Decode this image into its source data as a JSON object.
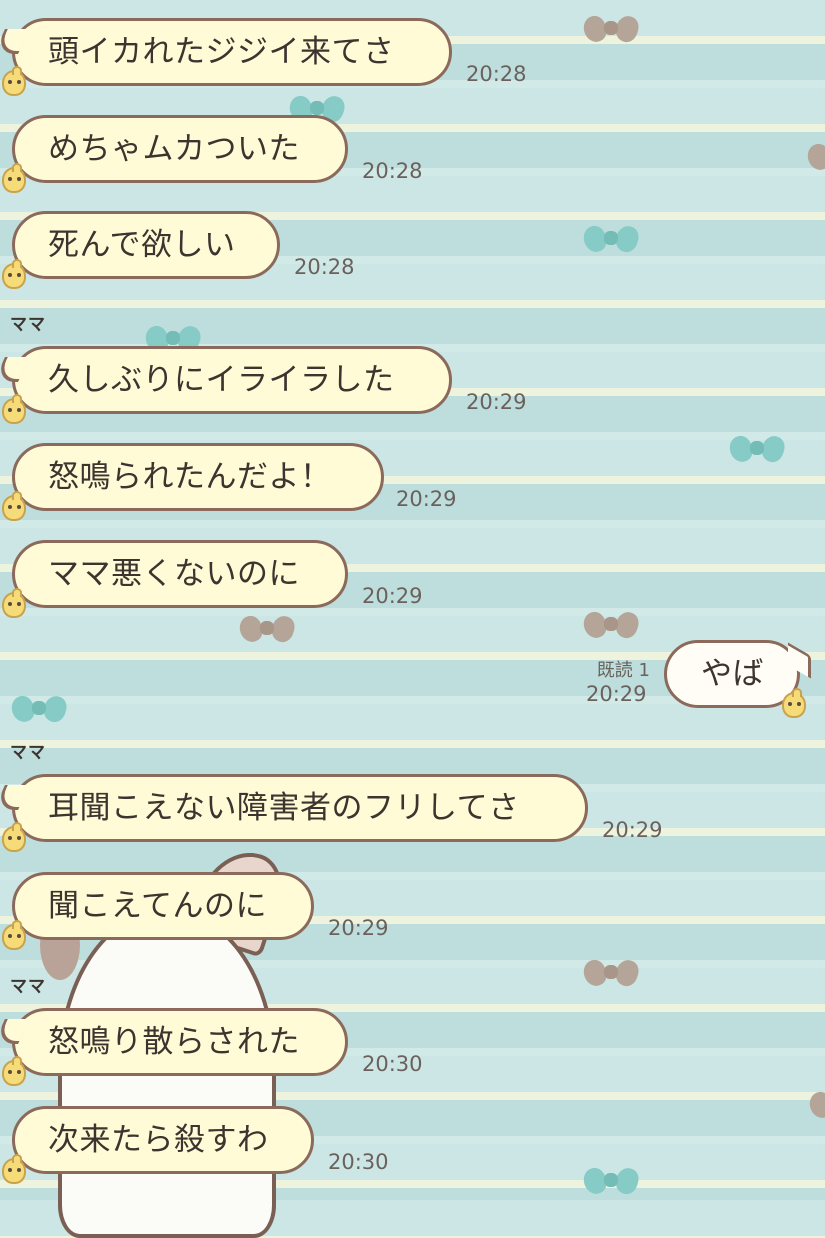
{
  "chat": {
    "messages": [
      {
        "sender": "",
        "text": "頭イカれたジジイ来てさ",
        "time": "20:28",
        "mine": false
      },
      {
        "sender": "",
        "text": "めちゃムカついた",
        "time": "20:28",
        "mine": false
      },
      {
        "sender": "",
        "text": "死んで欲しい",
        "time": "20:28",
        "mine": false
      },
      {
        "sender": "ママ",
        "text": "久しぶりにイライラした",
        "time": "20:29",
        "mine": false
      },
      {
        "sender": "",
        "text": "怒鳴られたんだよ！",
        "time": "20:29",
        "mine": false
      },
      {
        "sender": "",
        "text": "ママ悪くないのに",
        "time": "20:29",
        "mine": false
      },
      {
        "sender": "",
        "text": "やば",
        "time": "20:29",
        "mine": true,
        "read_status": "既読 1"
      },
      {
        "sender": "ママ",
        "text": "耳聞こえない障害者のフリしてさ",
        "time": "20:29",
        "mine": false
      },
      {
        "sender": "",
        "text": "聞こえてんのに",
        "time": "20:29",
        "mine": false
      },
      {
        "sender": "ママ",
        "text": "怒鳴り散らされた",
        "time": "20:30",
        "mine": false
      },
      {
        "sender": "",
        "text": "次来たら殺すわ",
        "time": "20:30",
        "mine": false
      }
    ]
  },
  "theme": {
    "bubble_fill": "#fffbd6",
    "bubble_border": "#8b6a5c",
    "background": "#c4e3e1",
    "stripe_light": "#eef3dd"
  },
  "icons": {
    "avatar": "chick-icon",
    "background_decoration": "bow-icon"
  }
}
